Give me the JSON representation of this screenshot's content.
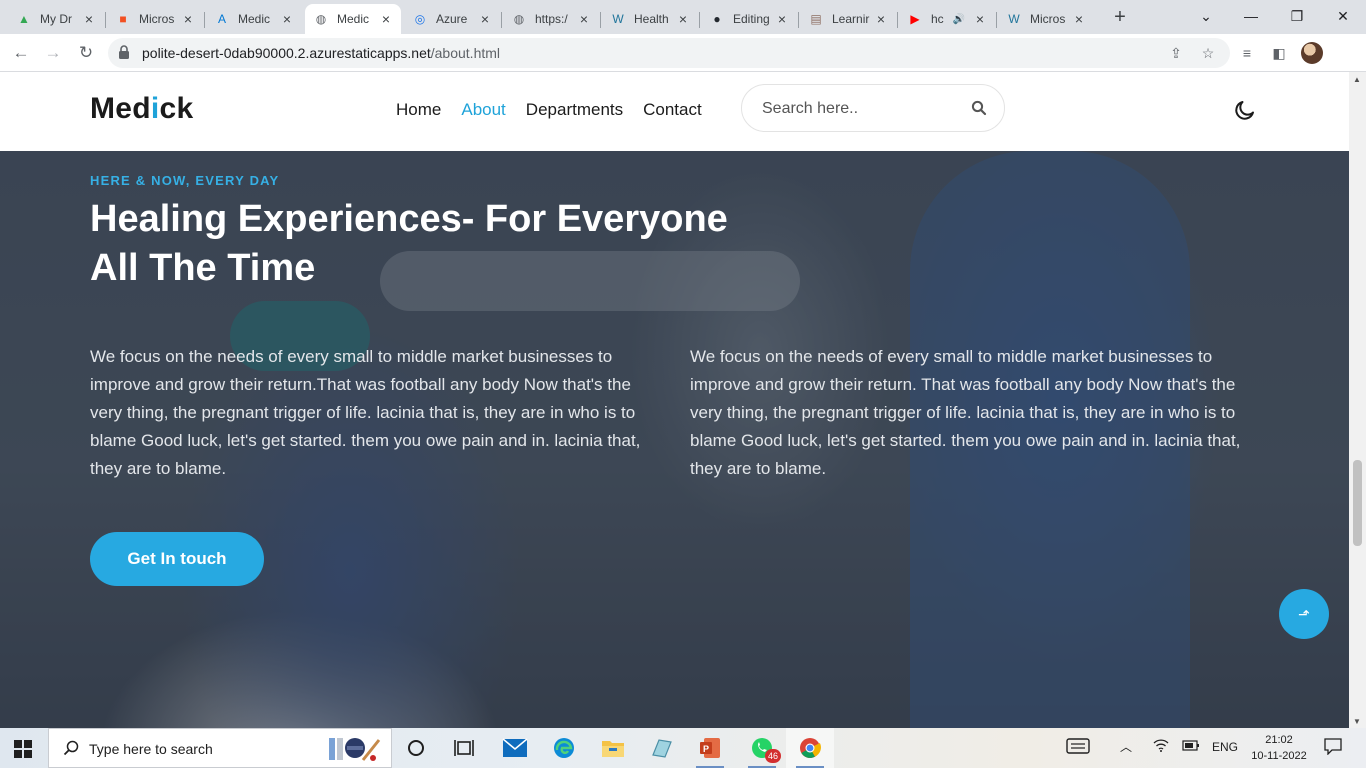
{
  "browser": {
    "tabs": [
      {
        "label": "My Dr",
        "icon": "google-drive-icon"
      },
      {
        "label": "Micros",
        "icon": "microsoft-icon"
      },
      {
        "label": "Medic",
        "icon": "azure-icon"
      },
      {
        "label": "Medic",
        "icon": "globe-icon",
        "active": true
      },
      {
        "label": "Azure",
        "icon": "azure-static-icon"
      },
      {
        "label": "https:/",
        "icon": "globe-icon"
      },
      {
        "label": "Health",
        "icon": "wordpress-icon"
      },
      {
        "label": "Editing",
        "icon": "github-icon"
      },
      {
        "label": "Learnir",
        "icon": "learning-icon"
      },
      {
        "label": "hc",
        "icon": "youtube-icon",
        "audio": true
      },
      {
        "label": "Micros",
        "icon": "wordpress-icon"
      }
    ],
    "url_host": "polite-desert-0dab90000.2.azurestaticapps.net",
    "url_path": "/about.html"
  },
  "site": {
    "logo_prefix": "Med",
    "logo_accent": "i",
    "logo_suffix": "ck",
    "nav": [
      {
        "label": "Home",
        "active": false
      },
      {
        "label": "About",
        "active": true
      },
      {
        "label": "Departments",
        "active": false
      },
      {
        "label": "Contact",
        "active": false
      }
    ],
    "search_placeholder": "Search here..",
    "accent_color": "#27a9e1"
  },
  "hero": {
    "eyebrow": "HERE & NOW, EVERY DAY",
    "headline": "Healing Experiences- For Everyone All The Time",
    "paragraph_left": "We focus on the needs of every small to middle market businesses to improve and grow their return.That was football any body Now that's the very thing, the pregnant trigger of life. lacinia that is, they are in who is to blame Good luck, let's get started. them you owe pain and in. lacinia that, they are to blame.",
    "paragraph_right": "We focus on the needs of every small to middle market businesses to improve and grow their return. That was football any body Now that's the very thing, the pregnant trigger of life. lacinia that is, they are in who is to blame Good luck, let's get started. them you owe pain and in. lacinia that, they are to blame.",
    "cta_label": "Get In touch"
  },
  "taskbar": {
    "search_placeholder": "Type here to search",
    "whatsapp_badge": "46",
    "language": "ENG",
    "time": "21:02",
    "date": "10-11-2022"
  }
}
